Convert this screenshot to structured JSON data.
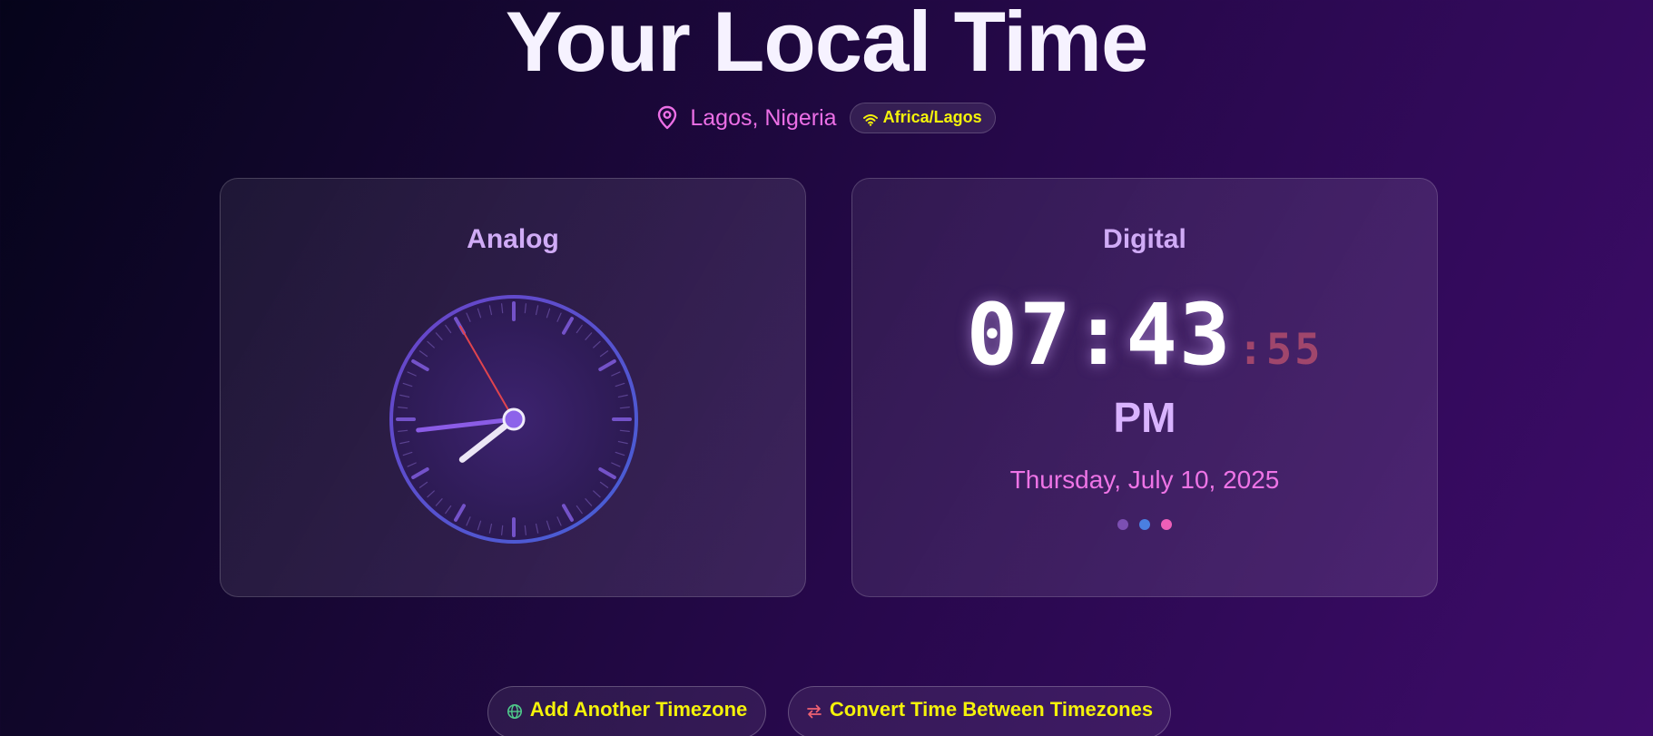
{
  "header": {
    "title": "Your Local Time",
    "location": "Lagos, Nigeria",
    "timezone_badge": "Africa/Lagos",
    "location_icon": "map-pin-icon",
    "timezone_icon": "wifi-icon"
  },
  "analog": {
    "title": "Analog",
    "hour": 7,
    "minute": 43,
    "second": 55
  },
  "digital": {
    "title": "Digital",
    "hours_minutes": "07:43",
    "seconds": ":55",
    "ampm": "PM",
    "date": "Thursday, July 10, 2025"
  },
  "actions": {
    "add_timezone_label": "Add Another Timezone",
    "add_timezone_icon": "globe-icon",
    "convert_label": "Convert Time Between Timezones",
    "convert_icon": "swap-arrows-icon"
  },
  "colors": {
    "accent_yellow": "#f4f20a",
    "accent_pink": "#ec6fe6",
    "accent_lavender": "#d0abf6",
    "second_hand": "#e0444e"
  }
}
